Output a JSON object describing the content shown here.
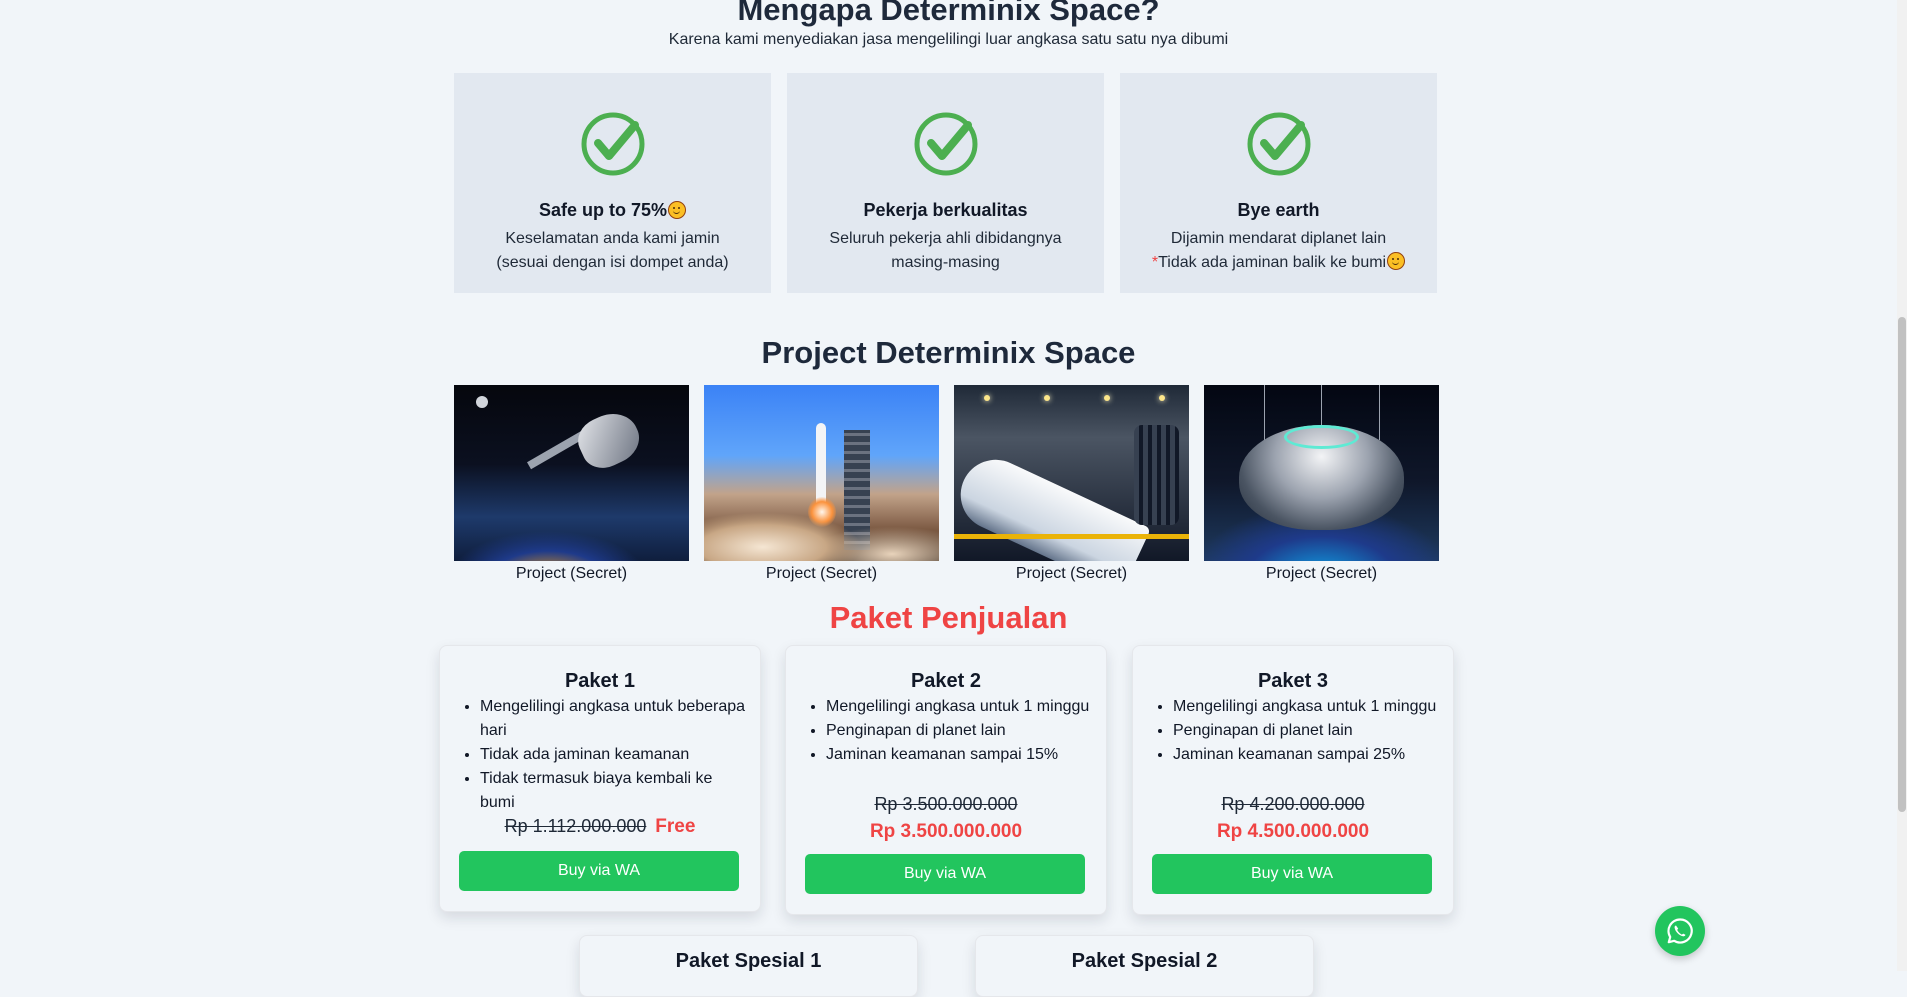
{
  "why": {
    "title": "Mengapa Determinix Space?",
    "subtitle": "Karena kami menyediakan jasa mengelilingi luar angkasa satu satu nya dibumi",
    "features": [
      {
        "icon": "check-icon",
        "title": "Safe up to 75%",
        "desc_line1": "Keselamatan anda kami jamin",
        "desc_line2": "(sesuai dengan isi dompet anda)"
      },
      {
        "icon": "check-icon",
        "title": "Pekerja berkualitas",
        "desc_line1": "Seluruh pekerja ahli dibidangnya",
        "desc_line2": "masing-masing"
      },
      {
        "icon": "check-icon",
        "title": "Bye earth",
        "desc_line1": "Dijamin mendarat diplanet lain",
        "desc_star": "*",
        "desc_line2": "Tidak ada jaminan balik ke bumi"
      }
    ]
  },
  "projects": {
    "title": "Project Determinix Space",
    "items": [
      {
        "caption": "Project (Secret)"
      },
      {
        "caption": "Project (Secret)"
      },
      {
        "caption": "Project (Secret)"
      },
      {
        "caption": "Project (Secret)"
      }
    ]
  },
  "packages": {
    "title": "Paket Penjualan",
    "cards": [
      {
        "name": "Paket 1",
        "features": [
          "Mengelilingi angkasa untuk beberapa hari",
          "Tidak ada jaminan keamanan",
          "Tidak termasuk biaya kembali ke bumi"
        ],
        "old_price": "Rp 1.112.000.000",
        "price": "Free",
        "button": "Buy via WA"
      },
      {
        "name": "Paket 2",
        "features": [
          "Mengelilingi angkasa untuk 1 minggu",
          "Penginapan di planet lain",
          "Jaminan keamanan sampai 15%"
        ],
        "old_price": "Rp 3.500.000.000",
        "price": "Rp 3.500.000.000",
        "button": "Buy via WA"
      },
      {
        "name": "Paket 3",
        "features": [
          "Mengelilingi angkasa untuk 1 minggu",
          "Penginapan di planet lain",
          "Jaminan keamanan sampai 25%"
        ],
        "old_price": "Rp 4.200.000.000",
        "price": "Rp 4.500.000.000",
        "button": "Buy via WA"
      }
    ],
    "special": [
      {
        "name": "Paket Spesial 1"
      },
      {
        "name": "Paket Spesial 2"
      }
    ]
  },
  "whatsapp_fab": {
    "icon": "whatsapp-icon"
  },
  "colors": {
    "accent_green": "#22c55e",
    "accent_red": "#ef4444",
    "check_green": "#4caf50",
    "feature_bg": "#e2e8f0",
    "page_bg": "#f1f5f9"
  }
}
